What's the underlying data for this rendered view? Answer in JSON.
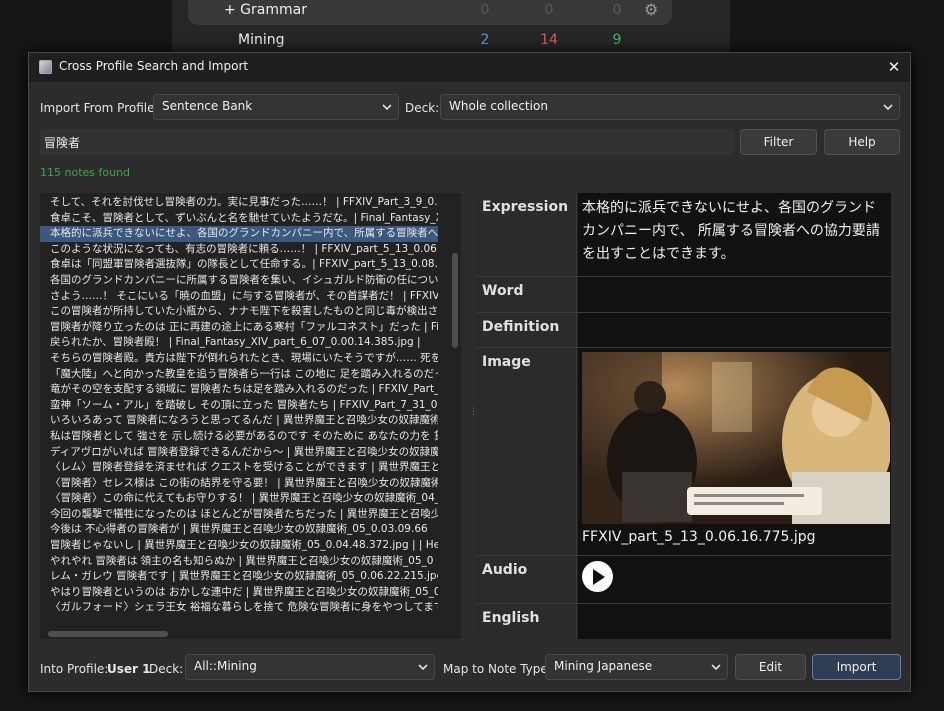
{
  "background": {
    "rows": [
      {
        "name": "+ Grammar",
        "new": "0",
        "learn": "0",
        "due": "0",
        "new_color": "#5a5a5a",
        "learn_color": "#5a5a5a",
        "due_color": "#5a5a5a"
      },
      {
        "name": "Mining",
        "new": "2",
        "learn": "14",
        "due": "9",
        "new_color": "#5b9bd5",
        "learn_color": "#e05a5a",
        "due_color": "#3bbf5a"
      }
    ],
    "gear_icon": "gear-icon"
  },
  "dialog": {
    "title": "Cross Profile Search and Import",
    "import_from_label": "Import From Profile:",
    "import_from_value": "Sentence Bank",
    "deck_label": "Deck:",
    "deck_value": "Whole collection",
    "search_value": "冒険者",
    "filter_label": "Filter",
    "help_label": "Help",
    "notes_found": "115 notes found",
    "results": [
      "そして、それを討伐せし冒険者の力。実に見事だった……！ | FFXIV_Part_3_9_0.0",
      "食卓こそ、冒険者として、ずいぶんと名を馳せていたようだな。| Final_Fantasy_XIV_p",
      "本格的に派兵できないにせよ、各国のグランドカンパニー内で、所属する冒険者への協",
      "このような状況になっても、有志の冒険者に頼る……！ | FFXIV_part_5_13_0.06.40",
      "食卓は「同盟軍冒険者選抜隊」の隊長として任命する。| FFXIV_part_5_13_0.08.05",
      "各国のグランドカンパニーに所属する冒険者を集い、イシュガルド防衛の任についても",
      "さよう……！ そこにいる「暁の血盟」に与する冒険者が、その首謀者だ！ | FFXIV_pa",
      "この冒険者が所持していた小瓶から、ナナモ陛下を殺害したものと同じ毒が検出され",
      "冒険者が降り立ったのは 正に再建の途上にある寒村「ファルコネスト」だった | Final_",
      "戻られたか、冒険者殿！ | Final_Fantasy_XIV_part_6_07_0.00.14.385.jpg |",
      "そちらの冒険者殿。貴方は陛下が倒れられたとき、現場にいたそうですが…… 死を",
      "「魔大陸」へと向かった教皇を追う冒険者ら一行は この地に 足を踏み入れるのだった",
      "竜がその空を支配する領域に 冒険者たちは足を踏み入れるのだった | FFXIV_Part_7_",
      "蛮神「ソーム・アル」を踏破し その頂に立った 冒険者たち | FFXIV_Part_7_31_0.01.42",
      "いろいろあって 冒険者になろうと思ってるんだ | 異世界魔王と召喚少女の奴隷魔術_0",
      "私は冒険者として 強さを 示し続ける必要があるのです そのために あなたの力を 貸して",
      "ディアヴロがいれば 冒険者登録できるんだから～ | 異世界魔王と召喚少女の奴隷魔",
      "〈レム〉冒険者登録を済ませれば クエストを受けることができます | 異世界魔王と召喚少",
      "〈冒険者〉セレス様は この街の結界を守る要！ | 異世界魔王と召喚少女の奴隷魔術",
      "〈冒険者〉この命に代えてもお守りする！ | 異世界魔王と召喚少女の奴隷魔術_04_0",
      "今回の襲撃で犠牲になったのは ほとんどが冒険者たちだった | 異世界魔王と召喚少女",
      "今後は 不心得者の冒険者が | 異世界魔王と召喚少女の奴隷魔術_05_0.03.09.66",
      "冒険者じゃないし | 異世界魔王と召喚少女の奴隷魔術_05_0.04.48.372.jpg | | He",
      "やれやれ 冒険者は 領主の名も知らぬか | 異世界魔王と召喚少女の奴隷魔術_05_0",
      "レム・ガレウ 冒険者です | 異世界魔王と召喚少女の奴隷魔術_05_0.06.22.215.jpg",
      "やはり冒険者というのは おかしな連中だ | 異世界魔王と召喚少女の奴隷魔術_05_0",
      "〈ガルフォード〉シェラ王女 裕福な暮らしを捨て 危険な冒険者に身をやつしてまで | 異せ"
    ],
    "selected_index": 2,
    "fields": {
      "expression_label": "Expression",
      "expression_value": "本格的に派兵できないにせよ、各国のグランドカンパニー内で、 所属する冒険者への協力要請を出すことはできます。",
      "word_label": "Word",
      "word_value": "",
      "definition_label": "Definition",
      "definition_value": "",
      "image_label": "Image",
      "image_filename": "FFXIV_part_5_13_0.06.16.775.jpg",
      "audio_label": "Audio",
      "play_icon": "play-icon",
      "english_label": "English",
      "english_value": ""
    },
    "footer": {
      "into_profile_label": "Into Profile:",
      "profile_name": "User 1",
      "deck_label": "Deck:",
      "deck_value": "All::Mining",
      "map_label": "Map to Note Type:",
      "note_type_value": "Mining Japanese",
      "edit_label": "Edit",
      "import_label": "Import",
      "import_accent": "#5a7fb8"
    }
  }
}
